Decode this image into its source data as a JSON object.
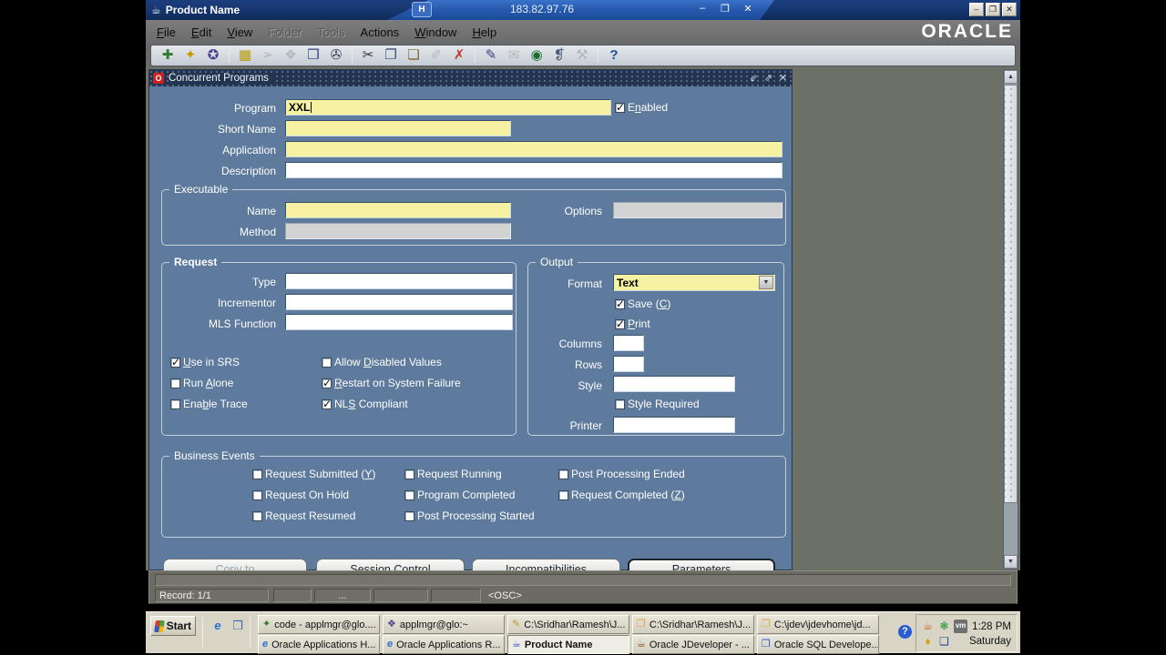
{
  "titlebar": {
    "app_title": "Product Name",
    "app_icon": "☕",
    "pin_label": "H",
    "remote_host": "183.82.97.76",
    "min_glyph": "–",
    "restore_glyph": "❐",
    "close_glyph": "✕"
  },
  "menubar": {
    "items": [
      {
        "label": "File",
        "u": 0,
        "disabled": false
      },
      {
        "label": "Edit",
        "u": 0,
        "disabled": false
      },
      {
        "label": "View",
        "u": 0,
        "disabled": false
      },
      {
        "label": "Folder",
        "u": -1,
        "disabled": true
      },
      {
        "label": "Tools",
        "u": -1,
        "disabled": true
      },
      {
        "label": "Actions",
        "u": -1,
        "disabled": false
      },
      {
        "label": "Window",
        "u": 0,
        "disabled": false
      },
      {
        "label": "Help",
        "u": 0,
        "disabled": false
      }
    ],
    "logo": "ORACLE"
  },
  "toolbar": {
    "icons": [
      {
        "name": "new-record-icon",
        "glyph": "✚",
        "color": "#2e7d32",
        "disabled": false
      },
      {
        "name": "find-icon",
        "glyph": "✦",
        "color": "#c79b00",
        "disabled": false
      },
      {
        "name": "show-navigator-icon",
        "glyph": "✪",
        "color": "#4a3f8f",
        "disabled": false
      },
      {
        "name": "save-icon",
        "glyph": "▦",
        "color": "#b59a00",
        "disabled": false
      },
      {
        "name": "next-step-icon",
        "glyph": "➢",
        "color": "#8a8a8a",
        "disabled": true
      },
      {
        "name": "switch-responsibility-icon",
        "glyph": "❖",
        "color": "#8a8a8a",
        "disabled": true
      },
      {
        "name": "print-icon",
        "glyph": "❒",
        "color": "#2f3f7f",
        "disabled": false
      },
      {
        "name": "close-form-icon",
        "glyph": "✇",
        "color": "#3f3f5f",
        "disabled": false
      },
      {
        "name": "cut-icon",
        "glyph": "✂",
        "color": "#333333",
        "disabled": false
      },
      {
        "name": "copy-icon",
        "glyph": "❐",
        "color": "#33527f",
        "disabled": false
      },
      {
        "name": "paste-icon",
        "glyph": "❏",
        "color": "#7f6a33",
        "disabled": false
      },
      {
        "name": "edit-icon",
        "glyph": "✐",
        "color": "#8a8a8a",
        "disabled": true
      },
      {
        "name": "clear-record-icon",
        "glyph": "✗",
        "color": "#c0392b",
        "disabled": false
      },
      {
        "name": "edit-field-icon",
        "glyph": "✎",
        "color": "#33427f",
        "disabled": false
      },
      {
        "name": "zoom-icon",
        "glyph": "✉",
        "color": "#8a8a8a",
        "disabled": true
      },
      {
        "name": "translations-icon",
        "glyph": "◉",
        "color": "#1c6e2e",
        "disabled": false
      },
      {
        "name": "attachments-icon",
        "glyph": "❡",
        "color": "#4a5a7a",
        "disabled": false
      },
      {
        "name": "folder-tools-icon",
        "glyph": "⚒",
        "color": "#8a8a8a",
        "disabled": true
      },
      {
        "name": "help-icon",
        "glyph": "?",
        "color": "#1c4e9e",
        "disabled": false
      }
    ]
  },
  "mdi": {
    "window_title": "Concurrent Programs",
    "window_icon": "O",
    "min_glyph": "⇙",
    "restore_glyph": "⇗",
    "close_glyph": "✕"
  },
  "form": {
    "program_label": "Program",
    "program_value": "XXL",
    "enabled": {
      "label": "Enabled",
      "u": 1,
      "checked": true
    },
    "short_name_label": "Short Name",
    "application_label": "Application",
    "description_label": "Description",
    "executable": {
      "title": "Executable",
      "name_label": "Name",
      "options_label": "Options",
      "method_label": "Method"
    },
    "request": {
      "title": "Request",
      "type_label": "Type",
      "incrementor_label": "Incrementor",
      "mls_label": "MLS Function",
      "checks": [
        {
          "label": "Use in SRS",
          "u": 0,
          "checked": true
        },
        {
          "label": "Run Alone",
          "u": 4,
          "checked": false
        },
        {
          "label": "Enable Trace",
          "u": 3,
          "checked": false
        },
        {
          "label": "Allow Disabled Values",
          "u": 6,
          "checked": false
        },
        {
          "label": "Restart on System Failure",
          "u": 0,
          "checked": true
        },
        {
          "label": "NLS Compliant",
          "u": 2,
          "checked": true
        }
      ]
    },
    "output": {
      "title": "Output",
      "format_label": "Format",
      "format_value": "Text",
      "save": {
        "label": "Save (C)",
        "u": 6,
        "checked": true
      },
      "print": {
        "label": "Print",
        "u": 0,
        "checked": true
      },
      "columns_label": "Columns",
      "rows_label": "Rows",
      "style_label": "Style",
      "style_required": {
        "label": "Style Required",
        "u": -1,
        "checked": false
      },
      "printer_label": "Printer"
    },
    "business_events": {
      "title": "Business Events",
      "checks": [
        {
          "label": "Request Submitted (Y)",
          "u": 19,
          "checked": false
        },
        {
          "label": "Request On Hold",
          "u": -1,
          "checked": false
        },
        {
          "label": "Request Resumed",
          "u": -1,
          "checked": false
        },
        {
          "label": "Request Running",
          "u": -1,
          "checked": false
        },
        {
          "label": "Program Completed",
          "u": -1,
          "checked": false
        },
        {
          "label": "Post Processing Started",
          "u": -1,
          "checked": false
        },
        {
          "label": "Post Processing Ended",
          "u": -1,
          "checked": false
        },
        {
          "label": "Request Completed (Z)",
          "u": 19,
          "checked": false
        }
      ]
    },
    "buttons": [
      {
        "label": "Copy to",
        "disabled": true,
        "default": false
      },
      {
        "label": "Session Control",
        "disabled": false,
        "default": false
      },
      {
        "label": "Incompatibilities",
        "disabled": false,
        "default": false
      },
      {
        "label": "Parameters",
        "disabled": false,
        "default": true
      }
    ]
  },
  "statusbar": {
    "record": "Record: 1/1",
    "dots": "...",
    "osc": "<OSC>"
  },
  "taskbar": {
    "start_label": "Start",
    "quick_launch": [
      {
        "name": "internet-explorer-icon",
        "glyph": "e",
        "color": "#2a6fd6"
      },
      {
        "name": "show-desktop-icon",
        "glyph": "❒",
        "color": "#3a6ea5"
      }
    ],
    "row1": [
      {
        "label": "code - applmgr@glo....",
        "icon": "✦",
        "color": "#2a7d2a"
      },
      {
        "label": "applmgr@glo:~",
        "icon": "❖",
        "color": "#4a4a8a"
      },
      {
        "label": "C:\\Sridhar\\Ramesh\\J...",
        "icon": "✎",
        "color": "#b8962e"
      },
      {
        "label": "C:\\Sridhar\\Ramesh\\J...",
        "icon": "❒",
        "color": "#d9a93f"
      },
      {
        "label": "C:\\jdev\\jdevhome\\jd...",
        "icon": "❒",
        "color": "#d9a93f"
      }
    ],
    "row2": [
      {
        "label": "Oracle Applications H...",
        "icon": "e",
        "color": "#2a6fd6",
        "active": false
      },
      {
        "label": "Oracle Applications R...",
        "icon": "e",
        "color": "#2a6fd6",
        "active": false
      },
      {
        "label": "Product Name",
        "icon": "☕",
        "color": "#3355bb",
        "active": true
      },
      {
        "label": "Oracle JDeveloper - ...",
        "icon": "☕",
        "color": "#8a5a2a",
        "active": false
      },
      {
        "label": "Oracle SQL Develope...",
        "icon": "❒",
        "color": "#2a5adb",
        "active": false
      }
    ],
    "tray": {
      "help_glyph": "?",
      "icons": [
        {
          "name": "java-tray-icon",
          "glyph": "☕",
          "color": "#cc6a1e"
        },
        {
          "name": "vmware-tools-icon",
          "glyph": "❃",
          "color": "#3f9d3f"
        },
        {
          "name": "vm-badge-icon",
          "glyph": "vm",
          "color": "#f0f0f0"
        },
        {
          "name": "security-agent-icon",
          "glyph": "♦",
          "color": "#d4a017"
        },
        {
          "name": "display-settings-icon",
          "glyph": "❑",
          "color": "#2a4a9a"
        }
      ],
      "time": "1:28 PM",
      "day": "Saturday"
    }
  }
}
